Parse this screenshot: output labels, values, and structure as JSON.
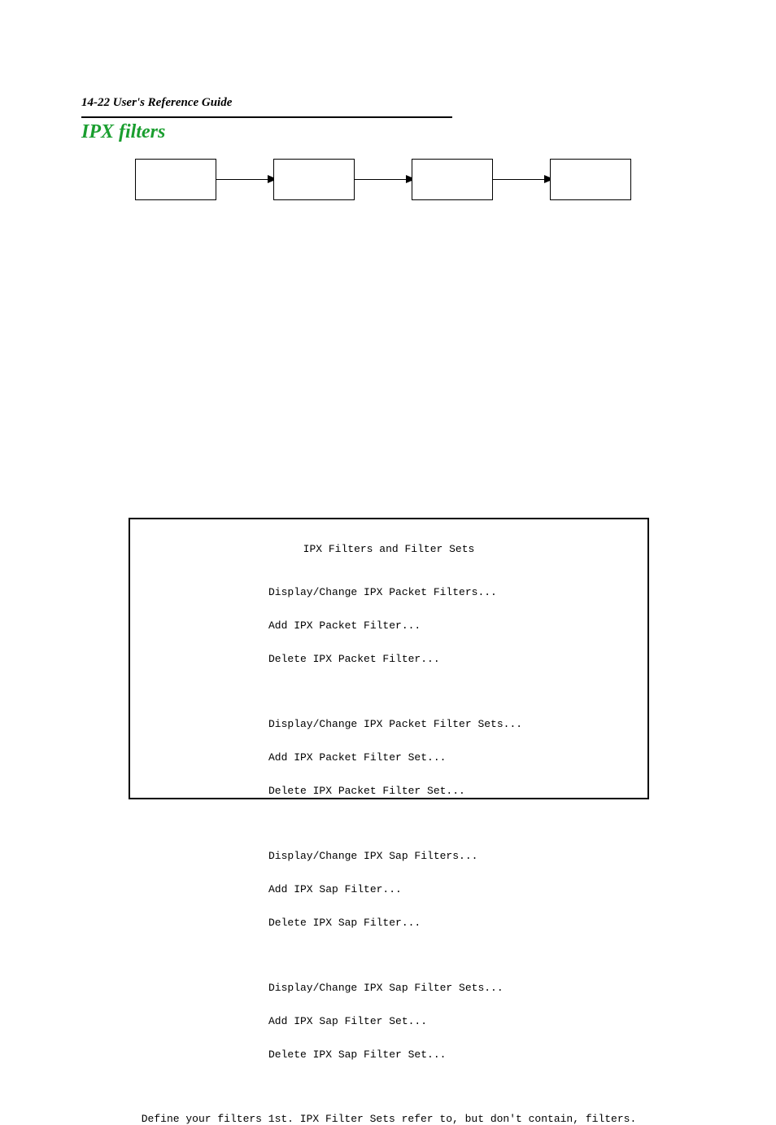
{
  "header": {
    "page_ref": "14-22  User's Reference Guide",
    "section_title": "IPX filters"
  },
  "flow": {
    "box1": "",
    "box2": "",
    "box3": "",
    "box4": ""
  },
  "terminal": {
    "title": "IPX Filters and Filter Sets",
    "group1": {
      "line1": "Display/Change IPX Packet Filters...",
      "line2": "Add IPX Packet Filter...",
      "line3": "Delete IPX Packet Filter..."
    },
    "group2": {
      "line1": "Display/Change IPX Packet Filter Sets...",
      "line2": "Add IPX Packet Filter Set...",
      "line3": "Delete IPX Packet Filter Set..."
    },
    "group3": {
      "line1": "Display/Change IPX Sap Filters...",
      "line2": "Add IPX Sap Filter...",
      "line3": "Delete IPX Sap Filter..."
    },
    "group4": {
      "line1": "Display/Change IPX Sap Filter Sets...",
      "line2": "Add IPX Sap Filter Set...",
      "line3": "Delete IPX Sap Filter Set..."
    },
    "footer": "Define your filters 1st. IPX Filter Sets refer to, but don't contain, filters."
  }
}
